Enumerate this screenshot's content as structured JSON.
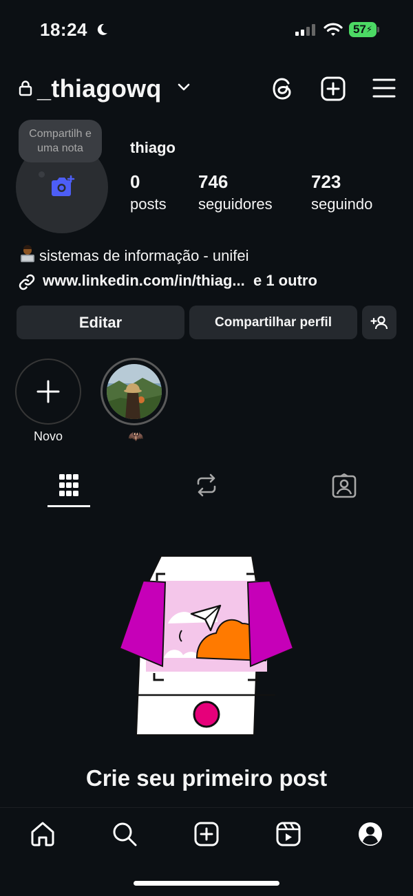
{
  "status_bar": {
    "time": "18:24",
    "battery": "57"
  },
  "header": {
    "username": "_thiagowq"
  },
  "note": {
    "text": "Compartilh e uma nota"
  },
  "profile": {
    "display_name": "thiago",
    "stats": [
      {
        "value": "0",
        "label": "posts"
      },
      {
        "value": "746",
        "label": "seguidores"
      },
      {
        "value": "723",
        "label": "seguindo"
      }
    ],
    "bio": "sistemas de informação - unifei",
    "link": "www.linkedin.com/in/thiag...  e 1 outro"
  },
  "actions": {
    "edit": "Editar",
    "share": "Compartilhar perfil"
  },
  "highlights": [
    {
      "label": "Novo"
    },
    {
      "label": "🦇"
    }
  ],
  "empty_state": {
    "title": "Crie seu primeiro post"
  },
  "colors": {
    "background": "#0c1014",
    "button": "#25292e",
    "accent": "#4d5ef6",
    "battery": "#4cd964"
  }
}
